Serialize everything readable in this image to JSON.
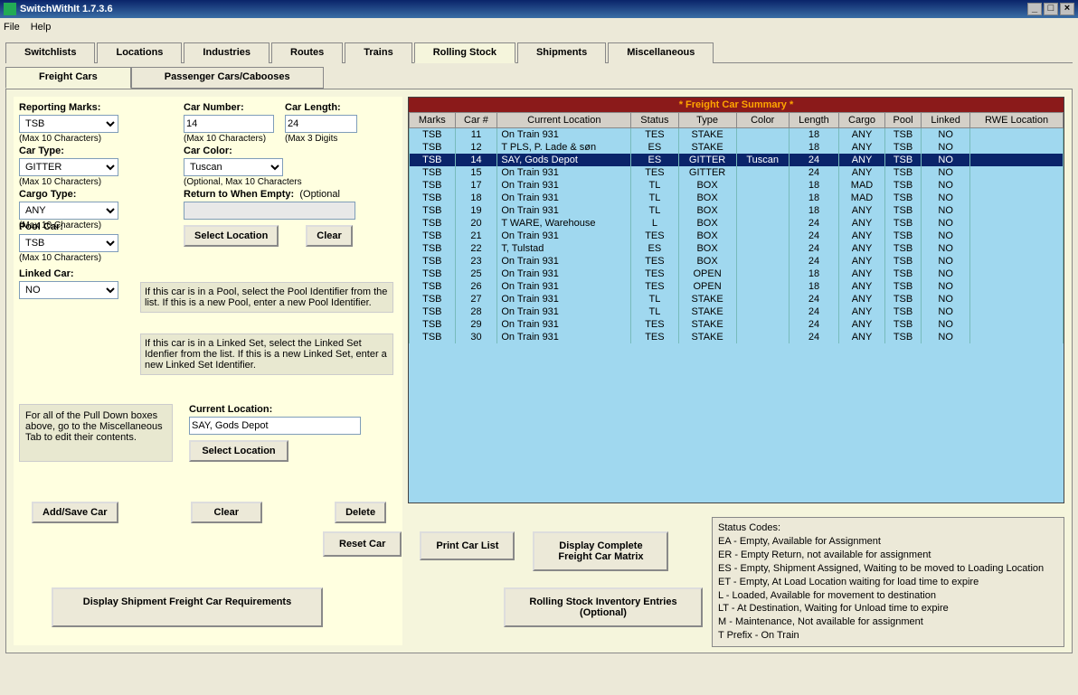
{
  "window": {
    "title": "SwitchWithIt 1.7.3.6"
  },
  "menu": {
    "file": "File",
    "help": "Help"
  },
  "tabs": [
    "Switchlists",
    "Locations",
    "Industries",
    "Routes",
    "Trains",
    "Rolling Stock",
    "Shipments",
    "Miscellaneous"
  ],
  "active_tab": 5,
  "subtabs": [
    "Freight Cars",
    "Passenger Cars/Cabooses"
  ],
  "active_subtab": 0,
  "form": {
    "reporting_marks": {
      "label": "Reporting Marks:",
      "value": "TSB",
      "hint": "(Max 10 Characters)"
    },
    "car_number": {
      "label": "Car Number:",
      "value": "14",
      "hint": "(Max 10 Characters)"
    },
    "car_length": {
      "label": "Car Length:",
      "value": "24",
      "hint": "(Max 3 Digits"
    },
    "car_type": {
      "label": "Car Type:",
      "value": "GITTER",
      "hint": "(Max 10 Characters)"
    },
    "car_color": {
      "label": "Car Color:",
      "value": "Tuscan",
      "hint": "(Optional, Max 10 Characters"
    },
    "cargo_type": {
      "label": "Cargo Type:",
      "value": "ANY",
      "hint": "(Max 10 Characters)"
    },
    "return_empty": {
      "label": "Return to When Empty:",
      "hint": "(Optional",
      "value": ""
    },
    "pool_car": {
      "label": "Pool Car:",
      "value": "TSB",
      "hint": "(Max 10 Characters)"
    },
    "linked_car": {
      "label": "Linked Car:",
      "value": "NO"
    },
    "current_location": {
      "label": "Current Location:",
      "value": "SAY, Gods Depot"
    },
    "select_location": "Select Location",
    "clear": "Clear",
    "pool_hint": "If this car is in a Pool, select the Pool Identifier from the list.  If this is a new Pool, enter a new Pool Identifier.",
    "linked_hint": "If this car is in a Linked Set, select the Linked Set Idenfier from the list.  If this is a new Linked Set, enter a new Linked Set Identifier.",
    "pulldown_note": "For all of the Pull Down boxes above, go to the Miscellaneous Tab to edit their contents."
  },
  "buttons": {
    "add_save": "Add/Save Car",
    "clear": "Clear",
    "delete": "Delete",
    "reset": "Reset Car",
    "print": "Print Car List",
    "matrix": "Display Complete Freight Car Matrix",
    "shipreq": "Display Shipment Freight Car Requirements",
    "inv": "Rolling Stock Inventory Entries (Optional)"
  },
  "summary": {
    "title": "* Freight Car Summary *",
    "headers": [
      "Marks",
      "Car #",
      "Current Location",
      "Status",
      "Type",
      "Color",
      "Length",
      "Cargo",
      "Pool",
      "Linked",
      "RWE Location"
    ],
    "selected": 2,
    "rows": [
      [
        "TSB",
        "11",
        "On Train 931",
        "TES",
        "STAKE",
        "",
        "18",
        "ANY",
        "TSB",
        "NO",
        ""
      ],
      [
        "TSB",
        "12",
        "T PLS, P. Lade & søn",
        "ES",
        "STAKE",
        "",
        "18",
        "ANY",
        "TSB",
        "NO",
        ""
      ],
      [
        "TSB",
        "14",
        "SAY, Gods Depot",
        "ES",
        "GITTER",
        "Tuscan",
        "24",
        "ANY",
        "TSB",
        "NO",
        ""
      ],
      [
        "TSB",
        "15",
        "On Train 931",
        "TES",
        "GITTER",
        "",
        "24",
        "ANY",
        "TSB",
        "NO",
        ""
      ],
      [
        "TSB",
        "17",
        "On Train 931",
        "TL",
        "BOX",
        "",
        "18",
        "MAD",
        "TSB",
        "NO",
        ""
      ],
      [
        "TSB",
        "18",
        "On Train 931",
        "TL",
        "BOX",
        "",
        "18",
        "MAD",
        "TSB",
        "NO",
        ""
      ],
      [
        "TSB",
        "19",
        "On Train 931",
        "TL",
        "BOX",
        "",
        "18",
        "ANY",
        "TSB",
        "NO",
        ""
      ],
      [
        "TSB",
        "20",
        "T WARE, Warehouse",
        "L",
        "BOX",
        "",
        "24",
        "ANY",
        "TSB",
        "NO",
        ""
      ],
      [
        "TSB",
        "21",
        "On Train 931",
        "TES",
        "BOX",
        "",
        "24",
        "ANY",
        "TSB",
        "NO",
        ""
      ],
      [
        "TSB",
        "22",
        "T, Tulstad",
        "ES",
        "BOX",
        "",
        "24",
        "ANY",
        "TSB",
        "NO",
        ""
      ],
      [
        "TSB",
        "23",
        "On Train 931",
        "TES",
        "BOX",
        "",
        "24",
        "ANY",
        "TSB",
        "NO",
        ""
      ],
      [
        "TSB",
        "25",
        "On Train 931",
        "TES",
        "OPEN",
        "",
        "18",
        "ANY",
        "TSB",
        "NO",
        ""
      ],
      [
        "TSB",
        "26",
        "On Train 931",
        "TES",
        "OPEN",
        "",
        "18",
        "ANY",
        "TSB",
        "NO",
        ""
      ],
      [
        "TSB",
        "27",
        "On Train 931",
        "TL",
        "STAKE",
        "",
        "24",
        "ANY",
        "TSB",
        "NO",
        ""
      ],
      [
        "TSB",
        "28",
        "On Train 931",
        "TL",
        "STAKE",
        "",
        "24",
        "ANY",
        "TSB",
        "NO",
        ""
      ],
      [
        "TSB",
        "29",
        "On Train 931",
        "TES",
        "STAKE",
        "",
        "24",
        "ANY",
        "TSB",
        "NO",
        ""
      ],
      [
        "TSB",
        "30",
        "On Train 931",
        "TES",
        "STAKE",
        "",
        "24",
        "ANY",
        "TSB",
        "NO",
        ""
      ]
    ]
  },
  "status": {
    "title": "Status Codes:",
    "lines": [
      "EA - Empty, Available for Assignment",
      "ER - Empty Return, not available for assignment",
      "ES - Empty, Shipment Assigned, Waiting to be moved to Loading Location",
      "ET - Empty, At Load Location waiting for load time to expire",
      "L - Loaded, Available for movement to destination",
      "LT - At Destination, Waiting for Unload time to expire",
      "M - Maintenance, Not available for assignment",
      "T Prefix - On Train"
    ]
  }
}
